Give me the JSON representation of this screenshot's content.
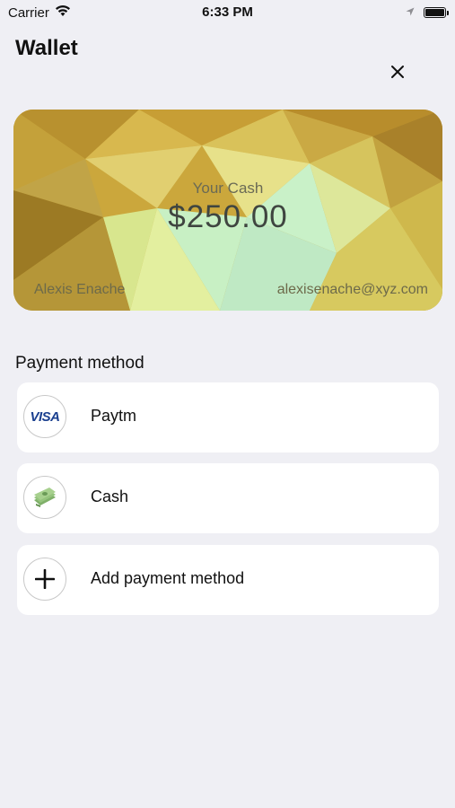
{
  "status_bar": {
    "carrier": "Carrier",
    "time": "6:33 PM",
    "icons": [
      "wifi-icon",
      "location-arrow-icon",
      "battery-icon"
    ]
  },
  "header": {
    "title": "Wallet",
    "close_icon": "close-icon"
  },
  "card": {
    "label": "Your Cash",
    "amount": "$250.00",
    "holder_name": "Alexis Enache",
    "email": "alexisenache@xyz.com"
  },
  "payment": {
    "section_title": "Payment method",
    "methods": [
      {
        "label": "Paytm",
        "icon": "visa-icon",
        "icon_text": "VISA"
      },
      {
        "label": "Cash",
        "icon": "cash-icon"
      },
      {
        "label": "Add payment method",
        "icon": "plus-icon"
      }
    ]
  },
  "colors": {
    "background": "#efeff4",
    "card_gold": "#c9a83a",
    "card_mint": "#c8f0d0",
    "visa_blue": "#1a3f8f"
  }
}
